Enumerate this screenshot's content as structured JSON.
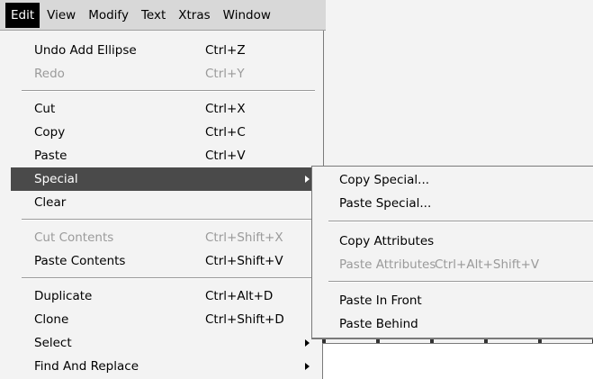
{
  "menubar": {
    "items": [
      {
        "label": "Edit"
      },
      {
        "label": "View"
      },
      {
        "label": "Modify"
      },
      {
        "label": "Text"
      },
      {
        "label": "Xtras"
      },
      {
        "label": "Window"
      }
    ]
  },
  "edit_menu": {
    "items": [
      {
        "label": "Undo Add Ellipse",
        "shortcut": "Ctrl+Z"
      },
      {
        "label": "Redo",
        "shortcut": "Ctrl+Y"
      },
      {
        "label": "Cut",
        "shortcut": "Ctrl+X"
      },
      {
        "label": "Copy",
        "shortcut": "Ctrl+C"
      },
      {
        "label": "Paste",
        "shortcut": "Ctrl+V"
      },
      {
        "label": "Special",
        "shortcut": ""
      },
      {
        "label": "Clear",
        "shortcut": ""
      },
      {
        "label": "Cut Contents",
        "shortcut": "Ctrl+Shift+X"
      },
      {
        "label": "Paste Contents",
        "shortcut": "Ctrl+Shift+V"
      },
      {
        "label": "Duplicate",
        "shortcut": "Ctrl+Alt+D"
      },
      {
        "label": "Clone",
        "shortcut": "Ctrl+Shift+D"
      },
      {
        "label": "Select",
        "shortcut": ""
      },
      {
        "label": "Find And Replace",
        "shortcut": ""
      }
    ]
  },
  "special_submenu": {
    "items": [
      {
        "label": "Copy Special...",
        "shortcut": ""
      },
      {
        "label": "Paste Special...",
        "shortcut": ""
      },
      {
        "label": "Copy Attributes",
        "shortcut": ""
      },
      {
        "label": "Paste Attributes",
        "shortcut": "Ctrl+Alt+Shift+V"
      },
      {
        "label": "Paste In Front",
        "shortcut": ""
      },
      {
        "label": "Paste Behind",
        "shortcut": ""
      }
    ]
  },
  "colors": {
    "highlight": "#4a4a4a",
    "disabled_text": "#9a9a9a",
    "active_menu": "#000000"
  }
}
